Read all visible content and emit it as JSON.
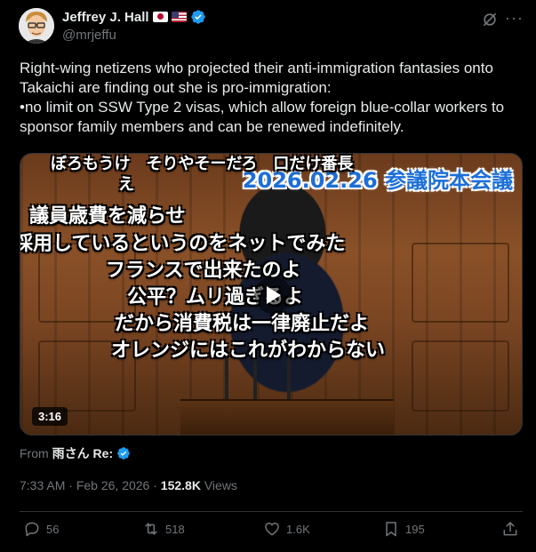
{
  "author": {
    "display_name": "Jeffrey J. Hall",
    "handle": "@mrjeffu",
    "flags": [
      "japan-flag",
      "us-flag"
    ],
    "verified": true
  },
  "post": {
    "text": "Right-wing netizens who projected their anti-immigration fantasies onto Takaichi are finding out she is pro-immigration:\n•no limit on SSW Type 2 visas, which allow foreign blue-collar workers to sponsor family members and can be renewed indefinitely."
  },
  "media": {
    "banner": "2026.02.26 参議院本会議",
    "overlay_lines": [
      "ぼろもうけ　そりやそーだろ　口だけ番長",
      "え",
      "議員歳費を減らせ",
      "採用しているというのをネットでみた",
      "フランスで出来たのよ",
      "公平？ムリ過ぎるよ",
      "だから消費税は一律廃止だよ",
      "オレンジにはこれがわからない"
    ],
    "duration": "3:16",
    "play_icon": "play-icon"
  },
  "from": {
    "prefix": "From",
    "name": "雨さん Re:",
    "verified": true
  },
  "meta": {
    "time": "7:33 AM",
    "separator": " · ",
    "date": "Feb 26, 2026",
    "dot": " · ",
    "views_count": "152.8K",
    "views_label": " Views"
  },
  "actions": {
    "replies": "56",
    "reposts": "518",
    "likes": "1.6K",
    "bookmarks": "195"
  },
  "colors": {
    "background": "#000000",
    "text": "#e7e9ea",
    "secondary": "#71767b",
    "verified": "#1d9bf0",
    "divider": "#2f3336"
  }
}
